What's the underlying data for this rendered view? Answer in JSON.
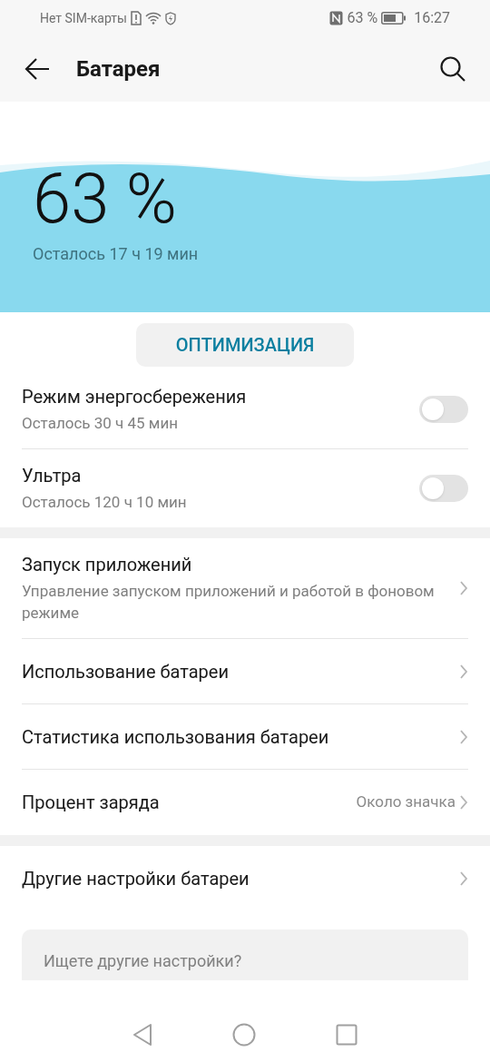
{
  "status_bar": {
    "carrier": "Нет SIM-карты",
    "battery": "63 %",
    "time": "16:27"
  },
  "header": {
    "title": "Батарея"
  },
  "hero": {
    "percent": "63 %",
    "remaining": "Осталось 17 ч 19 мин"
  },
  "optimize_button": "ОПТИМИЗАЦИЯ",
  "sections": [
    {
      "items": [
        {
          "kind": "toggle",
          "title": "Режим энергосбережения",
          "subtitle": "Осталось 30 ч 45 мин",
          "on": false
        },
        {
          "kind": "toggle",
          "title": "Ультра",
          "subtitle": "Осталось 120 ч 10 мин",
          "on": false
        }
      ]
    },
    {
      "items": [
        {
          "kind": "link",
          "title": "Запуск приложений",
          "subtitle": "Управление запуском приложений и работой в фоновом режиме"
        },
        {
          "kind": "link",
          "title": "Использование батареи"
        },
        {
          "kind": "link",
          "title": "Статистика использования батареи"
        },
        {
          "kind": "link",
          "title": "Процент заряда",
          "value": "Около значка"
        }
      ]
    },
    {
      "items": [
        {
          "kind": "link",
          "title": "Другие настройки батареи"
        }
      ]
    }
  ],
  "suggestion": {
    "title": "Ищете другие настройки?"
  }
}
